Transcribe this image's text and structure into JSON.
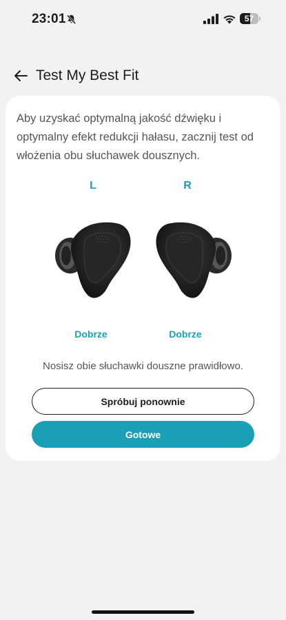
{
  "status_bar": {
    "time": "23:01",
    "battery_level": "57",
    "battery_fraction": 0.57,
    "icons": [
      "bell-slash-icon",
      "signal-icon",
      "wifi-icon",
      "battery-icon"
    ]
  },
  "header": {
    "back_icon": "arrow-left-icon",
    "title": "Test My Best Fit"
  },
  "card": {
    "instructions": "Aby uzyskać optymalną jakość dźwięku i optymalny efekt redukcji hałasu, zacznij test od włożenia obu słuchawek dousznych.",
    "left": {
      "label": "L",
      "status": "Dobrze"
    },
    "right": {
      "label": "R",
      "status": "Dobrze"
    },
    "result": "Nosisz obie słuchawki douszne prawidłowo.",
    "retry_label": "Spróbuj ponownie",
    "done_label": "Gotowe"
  },
  "colors": {
    "accent": "#1a9fb5",
    "background": "#f2f2f2",
    "card": "#ffffff",
    "earbud": "#1f1f1f"
  }
}
